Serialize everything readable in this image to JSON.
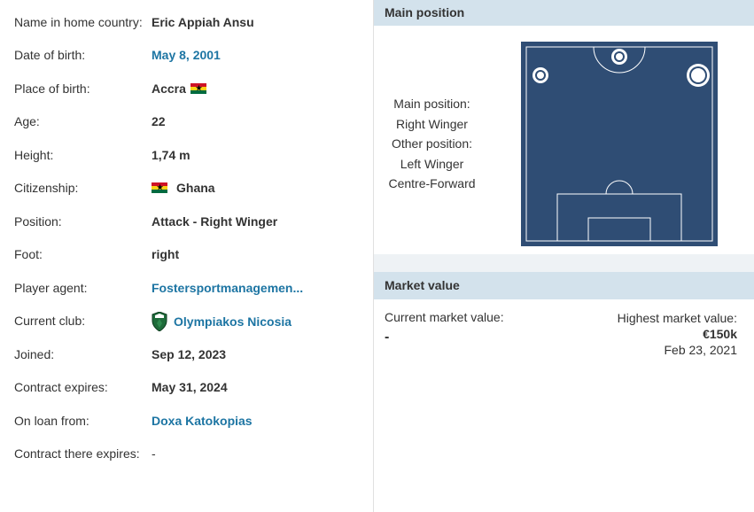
{
  "profile": {
    "rows": [
      {
        "label": "Name in home country:",
        "value": "Eric Appiah Ansu"
      },
      {
        "label": "Date of birth:",
        "value": "May 8, 2001"
      },
      {
        "label": "Place of birth:",
        "value": "Accra"
      },
      {
        "label": "Age:",
        "value": "22"
      },
      {
        "label": "Height:",
        "value": "1,74 m"
      },
      {
        "label": "Citizenship:",
        "value": "Ghana"
      },
      {
        "label": "Position:",
        "value": "Attack - Right Winger"
      },
      {
        "label": "Foot:",
        "value": "right"
      },
      {
        "label": "Player agent:",
        "value": "Fostersportmanagemen..."
      },
      {
        "label": "Current club:",
        "value": "Olympiakos Nicosia"
      },
      {
        "label": "Joined:",
        "value": "Sep 12, 2023"
      },
      {
        "label": "Contract expires:",
        "value": "May 31, 2024"
      },
      {
        "label": "On loan from:",
        "value": "Doxa Katokopias"
      },
      {
        "label": "Contract there expires:",
        "value": "-"
      }
    ]
  },
  "position": {
    "header": "Main position",
    "main_label": "Main position:",
    "main_value": "Right Winger",
    "other_label": "Other position:",
    "other_values": [
      "Left Winger",
      "Centre-Forward"
    ]
  },
  "market": {
    "header": "Market value",
    "current_label": "Current market value:",
    "current_value": "-",
    "highest_label": "Highest market value:",
    "highest_value": "€150k",
    "highest_date": "Feb 23, 2021"
  },
  "colors": {
    "link": "#1d75a3",
    "header_bg": "#d3e2ec",
    "pitch": "#2f4d74"
  },
  "icons": {
    "place_flag": "ghana-flag-icon",
    "citizenship_flag": "ghana-flag-icon",
    "club_crest": "olympiakos-nicosia-crest-icon"
  }
}
